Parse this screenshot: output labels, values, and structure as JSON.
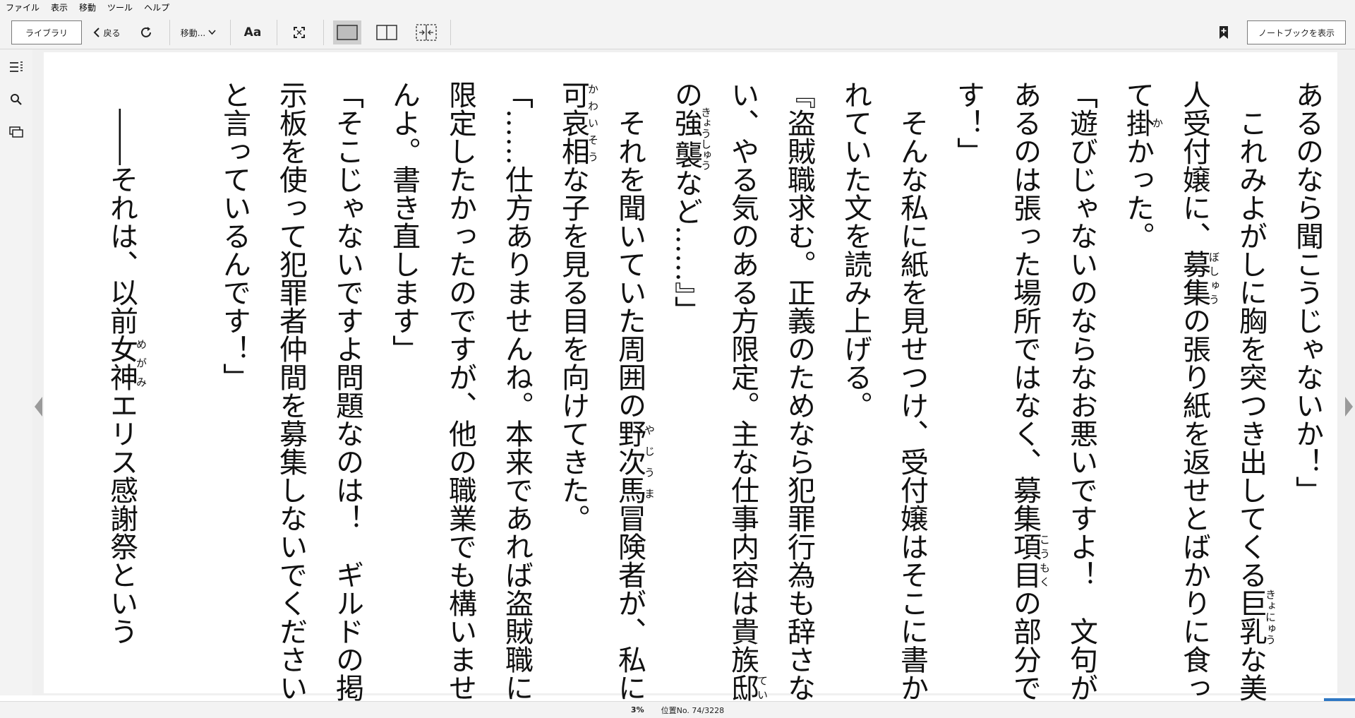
{
  "menu": [
    "ファイル",
    "表示",
    "移動",
    "ツール",
    "ヘルプ"
  ],
  "toolbar": {
    "library_label": "ライブラリ",
    "back_label": "戻る",
    "goto_label": "移動...",
    "font_label": "Aa",
    "notebook_label": "ノートブックを表示"
  },
  "icons": {
    "back": "chevron-left-icon",
    "refresh": "refresh-icon",
    "goto_dropdown": "chevron-down-icon",
    "fullscreen": "fullscreen-icon",
    "single_column": "single-column-icon",
    "two_column": "two-column-icon",
    "page_flip": "page-flip-icon",
    "bookmark": "bookmark-add-icon",
    "toc": "table-of-contents-icon",
    "search": "search-icon",
    "flashcards": "flashcards-icon",
    "prev_page": "prev-page-arrow-icon",
    "next_page": "next-page-arrow-icon"
  },
  "content": {
    "paragraphs": [
      [
        {
          "t": "あるのなら聞こうじゃないか！」"
        }
      ],
      [
        {
          "t": "　これみよがしに胸を突"
        },
        {
          "t": "つ",
          "r": ""
        },
        {
          "t": "き出してくる"
        },
        {
          "rb": "巨乳",
          "rt": "きょにゅう"
        },
        {
          "t": "な美人受付嬢に、"
        },
        {
          "rb": "募集",
          "rt": "ぼしゅう"
        },
        {
          "t": "の張り紙を返せとばかりに食って"
        },
        {
          "rb": "掛",
          "rt": "か"
        },
        {
          "t": "かった。"
        }
      ],
      [
        {
          "t": "「遊びじゃないのならなお悪いですよ！　文句があるのは張った場所ではなく、募集"
        },
        {
          "rb": "項目",
          "rt": "こうもく"
        },
        {
          "t": "の部分です！」"
        }
      ],
      [
        {
          "t": "　そんな私に紙を見せつけ、受付嬢はそこに書かれていた文を読み上げる。"
        }
      ],
      [
        {
          "t": "『盗賊職求む。正義のためなら犯罪行為も辞さない、やる気のある方限定。主な仕事内容は貴族"
        },
        {
          "rb": "邸",
          "rt": "てい"
        },
        {
          "t": "の"
        },
        {
          "rb": "強襲",
          "rt": "きょうしゅう"
        },
        {
          "t": "など……』」"
        }
      ],
      [
        {
          "t": "　それを聞いていた周囲の"
        },
        {
          "rb": "野次馬",
          "rt": "やじうま"
        },
        {
          "t": "冒険者が、私に"
        },
        {
          "rb": "可哀相",
          "rt": "かわいそう"
        },
        {
          "t": "な子を見る目を向けてきた。"
        }
      ],
      [
        {
          "t": "「……仕方ありませんね。本来であれば盗賊職に限定したかったのですが、他の職業でも構いませんよ。書き直します」"
        }
      ],
      [
        {
          "t": "「そこじゃないですよ問題なのは！　ギルドの掲示板を使って犯罪者仲間を募集しないでくださいと言っているんです！」"
        }
      ],
      [
        {
          "t": ""
        }
      ],
      [
        {
          "t": "　――それは、以前"
        },
        {
          "rb": "女神",
          "rt": "めがみ"
        },
        {
          "t": "エリス感謝祭という"
        }
      ]
    ]
  },
  "status": {
    "percent": "3%",
    "location": "位置No. 74/3228",
    "progress_fraction": 0.023
  },
  "colors": {
    "chrome_bg": "#f3f3f3",
    "page_bg": "#ffffff",
    "accent": "#2f78c4"
  }
}
